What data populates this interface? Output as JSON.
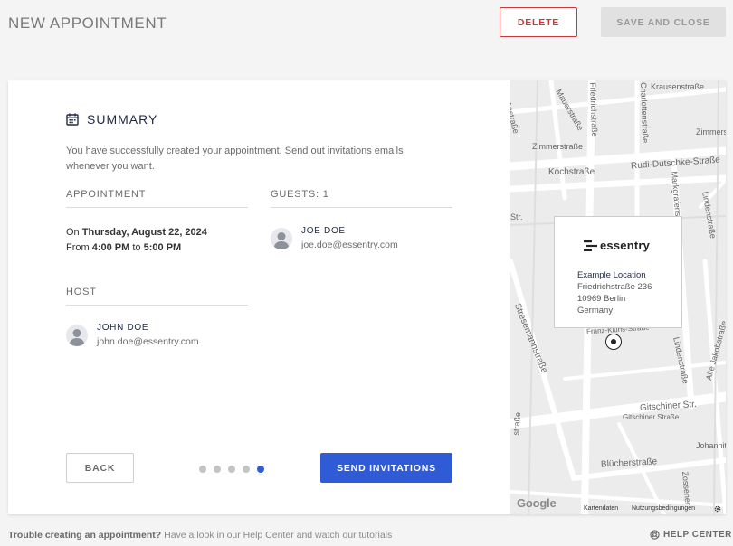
{
  "header": {
    "title": "NEW APPOINTMENT",
    "delete_label": "DELETE",
    "save_label": "SAVE AND CLOSE"
  },
  "summary": {
    "title": "SUMMARY",
    "icon": "calendar-icon",
    "intro": "You have successfully created your appointment. Send out invitations emails whenever you want.",
    "appointment_label": "APPOINTMENT",
    "guests_label": "GUESTS: 1",
    "host_label": "HOST",
    "date_prefix": "On",
    "date": "Thursday, August 22, 2024",
    "time_prefix": "From",
    "start_time": "4:00 PM",
    "time_sep": "to",
    "end_time": "5:00 PM",
    "guest": {
      "name": "JOE DOE",
      "email": "joe.doe@essentry.com"
    },
    "host": {
      "name": "JOHN DOE",
      "email": "john.doe@essentry.com"
    }
  },
  "wizard": {
    "back_label": "BACK",
    "send_label": "SEND INVITATIONS",
    "steps_total": 5,
    "current_step": 5
  },
  "map": {
    "brand": "essentry",
    "location_name": "Example Location",
    "street": "Friedrichstraße 236",
    "city": "10969 Berlin",
    "country": "Germany",
    "streets": [
      "Krausenstraße",
      "Mauerstraße",
      "Friedrichstraße",
      "Charlottenstraße",
      "Zimmerstraße",
      "Zimmers",
      "Kochstraße",
      "Rudi-Dutschke-Straße",
      "Markgrafenstraße",
      "Lindenstraße",
      "Stresemannstraße",
      "Franz-Klühs-Straße",
      "Gitschiner Str.",
      "Alte Jakobstraße",
      "Johannit",
      "Blücherstraße",
      "Zossener",
      "straße",
      "Str.",
      "Anstraße",
      "Gitschiner Straße",
      "Lindenstraße"
    ],
    "google": "Google",
    "kartendaten": "Kartendaten",
    "nutzung": "Nutzungsbedingungen"
  },
  "footer": {
    "bold_text": "Trouble creating an appointment?",
    "text": "Have a look in our Help Center and watch our tutorials",
    "help_label": "HELP CENTER"
  },
  "colors": {
    "primary": "#2f5bd6",
    "danger": "#c9393b",
    "disabled_bg": "#e1e1e1"
  }
}
